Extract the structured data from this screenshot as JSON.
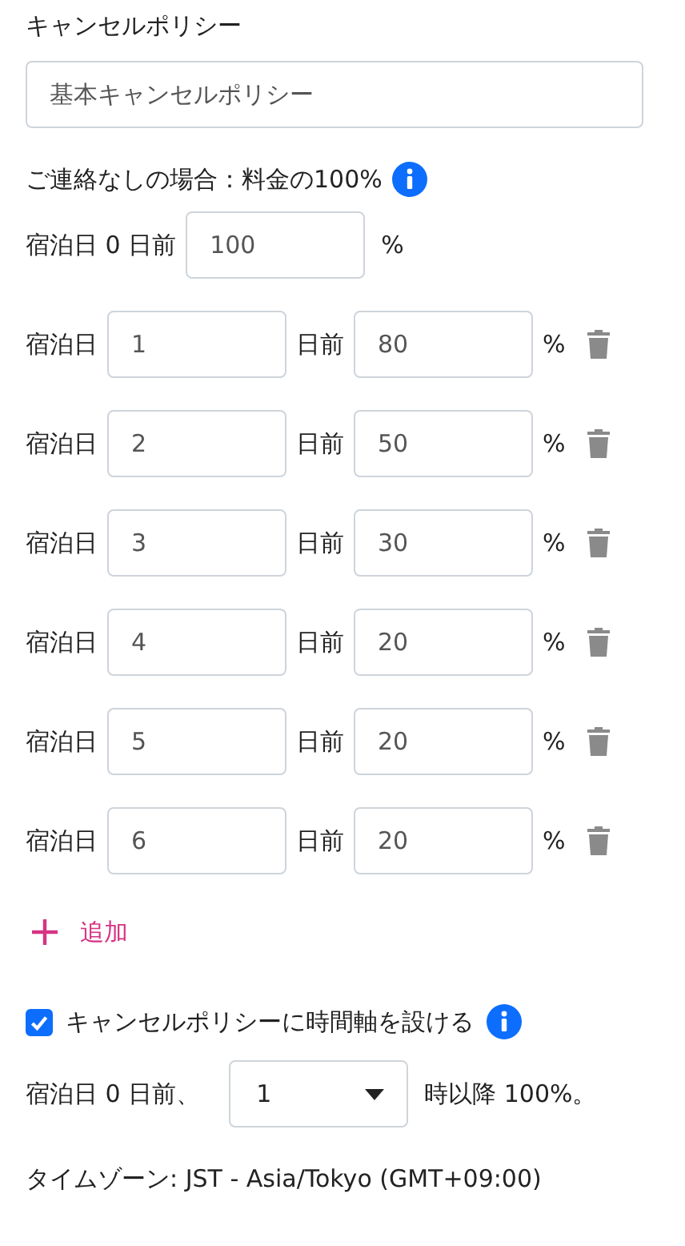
{
  "title": "キャンセルポリシー",
  "policy_name": {
    "value": "基本キャンセルポリシー"
  },
  "no_contact": {
    "text": "ご連絡なしの場合：料金の100%"
  },
  "same_day": {
    "label": "宿泊日 0 日前",
    "percent": "100",
    "unit": "%"
  },
  "tiers": [
    {
      "prefix": "宿泊日",
      "days": "1",
      "mid": "日前",
      "percent": "80",
      "unit": "%"
    },
    {
      "prefix": "宿泊日",
      "days": "2",
      "mid": "日前",
      "percent": "50",
      "unit": "%"
    },
    {
      "prefix": "宿泊日",
      "days": "3",
      "mid": "日前",
      "percent": "30",
      "unit": "%"
    },
    {
      "prefix": "宿泊日",
      "days": "4",
      "mid": "日前",
      "percent": "20",
      "unit": "%"
    },
    {
      "prefix": "宿泊日",
      "days": "5",
      "mid": "日前",
      "percent": "20",
      "unit": "%"
    },
    {
      "prefix": "宿泊日",
      "days": "6",
      "mid": "日前",
      "percent": "20",
      "unit": "%"
    }
  ],
  "add_button": {
    "label": "追加"
  },
  "time_axis": {
    "label": "キャンセルポリシーに時間軸を設ける",
    "checked": true
  },
  "time_rule": {
    "prefix": "宿泊日 0 日前、",
    "hour": "1",
    "suffix": "時以降 100%。"
  },
  "timezone": "タイムゾーン: JST - Asia/Tokyo (GMT+09:00)"
}
